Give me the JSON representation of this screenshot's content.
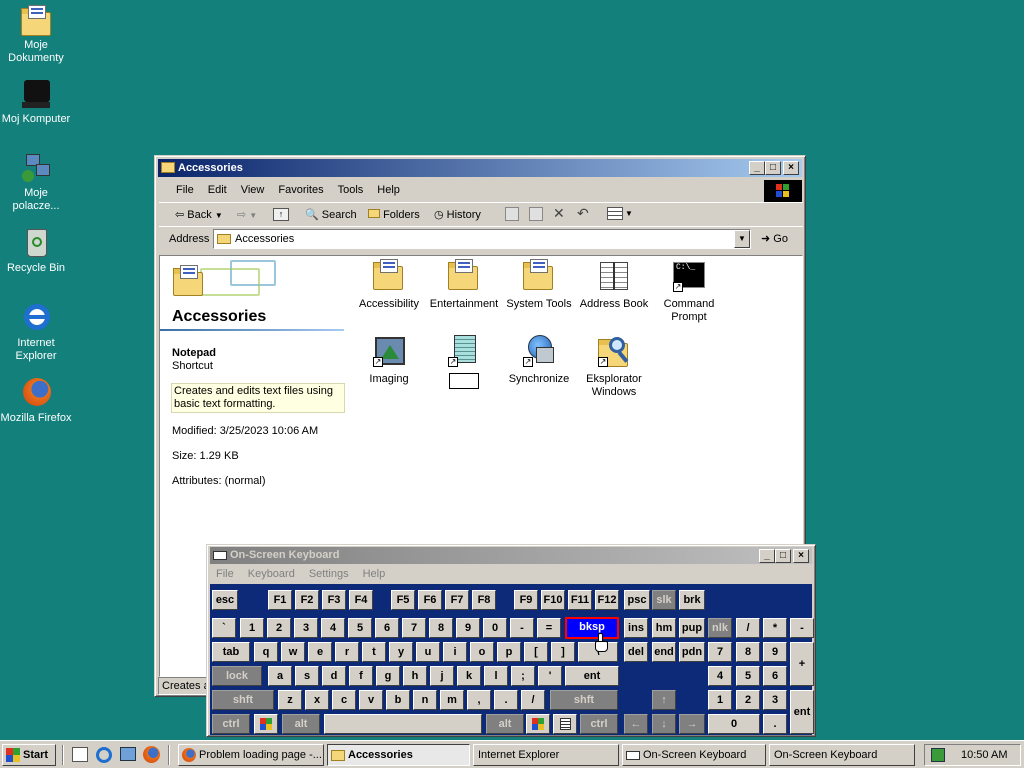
{
  "desktop": {
    "icons": [
      {
        "label": "Moje Dokumenty",
        "icon": "my-documents-icon"
      },
      {
        "label": "Moj Komputer",
        "icon": "my-computer-icon"
      },
      {
        "label": "Moje polacze...",
        "icon": "network-icon"
      },
      {
        "label": "Recycle Bin",
        "icon": "recycle-bin-icon"
      },
      {
        "label": "Internet Explorer",
        "icon": "internet-explorer-icon"
      },
      {
        "label": "Mozilla Firefox",
        "icon": "firefox-icon"
      }
    ]
  },
  "explorer": {
    "title": "Accessories",
    "menu": [
      "File",
      "Edit",
      "View",
      "Favorites",
      "Tools",
      "Help"
    ],
    "toolbar": {
      "back": "Back",
      "search": "Search",
      "folders": "Folders",
      "history": "History"
    },
    "address": {
      "label": "Address",
      "value": "Accessories",
      "go": "Go"
    },
    "panel": {
      "heading": "Accessories",
      "item_name": "Notepad",
      "item_type": "Shortcut",
      "description": "Creates and edits text files using basic text formatting.",
      "modified": "Modified: 3/25/2023 10:06 AM",
      "size": "Size: 1.29 KB",
      "attributes": "Attributes: (normal)"
    },
    "items": [
      {
        "label": "Accessibility",
        "icon": "folder-icon"
      },
      {
        "label": "Entertainment",
        "icon": "folder-icon"
      },
      {
        "label": "System Tools",
        "icon": "folder-icon"
      },
      {
        "label": "Address Book",
        "icon": "address-book-icon"
      },
      {
        "label": "Command Prompt",
        "icon": "command-prompt-icon"
      },
      {
        "label": "Imaging",
        "icon": "imaging-icon"
      },
      {
        "label": "",
        "icon": "notepad-icon"
      },
      {
        "label": "Synchronize",
        "icon": "synchronize-icon"
      },
      {
        "label": "Eksplorator Windows",
        "icon": "windows-explorer-icon"
      }
    ],
    "status": "Creates a"
  },
  "osk": {
    "title": "On-Screen Keyboard",
    "menu": [
      "File",
      "Keyboard",
      "Settings",
      "Help"
    ],
    "keys": {
      "esc": "esc",
      "f1": "F1",
      "f2": "F2",
      "f3": "F3",
      "f4": "F4",
      "f5": "F5",
      "f6": "F6",
      "f7": "F7",
      "f8": "F8",
      "f9": "F9",
      "f10": "F10",
      "f11": "F11",
      "f12": "F12",
      "psc": "psc",
      "slk": "slk",
      "brk": "brk",
      "grave": "`",
      "n1": "1",
      "n2": "2",
      "n3": "3",
      "n4": "4",
      "n5": "5",
      "n6": "6",
      "n7": "7",
      "n8": "8",
      "n9": "9",
      "n0": "0",
      "minus": "-",
      "equals": "=",
      "bksp": "bksp",
      "ins": "ins",
      "hm": "hm",
      "pup": "pup",
      "nlk": "nlk",
      "kp_div": "/",
      "kp_mul": "*",
      "kp_sub": "-",
      "tab": "tab",
      "q": "q",
      "w": "w",
      "e": "e",
      "r": "r",
      "t": "t",
      "y": "y",
      "u": "u",
      "i": "i",
      "o": "o",
      "p": "p",
      "lbr": "[",
      "rbr": "]",
      "bslash": "\\",
      "del": "del",
      "end": "end",
      "pdn": "pdn",
      "kp7": "7",
      "kp8": "8",
      "kp9": "9",
      "kp_add": "+",
      "lock": "lock",
      "a": "a",
      "s": "s",
      "d": "d",
      "f": "f",
      "g": "g",
      "h": "h",
      "j": "j",
      "k": "k",
      "l": "l",
      "semi": ";",
      "quote": "'",
      "ent": "ent",
      "kp4": "4",
      "kp5": "5",
      "kp6": "6",
      "shft": "shft",
      "z": "z",
      "x": "x",
      "c": "c",
      "v": "v",
      "b": "b",
      "n": "n",
      "m": "m",
      "comma": ",",
      "period": ".",
      "slash": "/",
      "rshft": "shft",
      "up": "↑",
      "kp1": "1",
      "kp2": "2",
      "kp3": "3",
      "ctrl": "ctrl",
      "alt": "alt",
      "ralt": "alt",
      "rctrl": "ctrl",
      "left": "←",
      "down": "↓",
      "right": "→",
      "kp0": "0",
      "kp_dot": ".",
      "kp_ent": "ent"
    }
  },
  "taskbar": {
    "start": "Start",
    "tasks": [
      {
        "label": "Problem loading page -...",
        "icon": "firefox-icon"
      },
      {
        "label": "Accessories",
        "icon": "folder-icon"
      },
      {
        "label": "Internet Explorer",
        "icon": ""
      },
      {
        "label": "On-Screen Keyboard",
        "icon": "keyboard-icon"
      },
      {
        "label": "On-Screen Keyboard",
        "icon": ""
      }
    ],
    "clock": "10:50 AM"
  }
}
